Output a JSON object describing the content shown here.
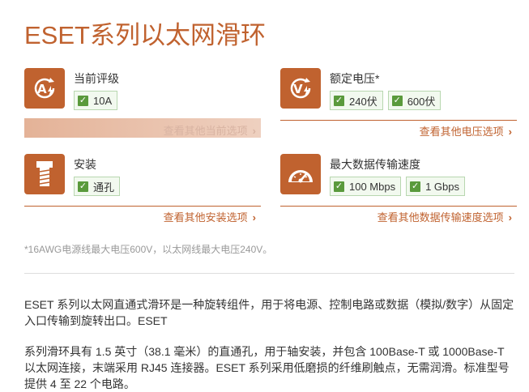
{
  "page": {
    "title": "ESET系列以太网滑环"
  },
  "specs": [
    {
      "label": "当前评级",
      "icon": "amp-rating-icon",
      "chips": [
        "10A"
      ],
      "link": "查看其他当前选项"
    },
    {
      "label": "额定电压*",
      "icon": "voltage-icon",
      "chips": [
        "240伏",
        "600伏"
      ],
      "link": "查看其他电压选项"
    },
    {
      "label": "安装",
      "icon": "bolt-icon",
      "chips": [
        "通孔"
      ],
      "link": "查看其他安装选项"
    },
    {
      "label": "最大数据传输速度",
      "icon": "speedometer-icon",
      "chips": [
        "100 Mbps",
        "1 Gbps"
      ],
      "link": "查看其他数据传输速度选项"
    }
  ],
  "note": "*16AWG电源线最大电压600V，以太网线最大电压240V。",
  "description": [
    "ESET 系列以太网直通式滑环是一种旋转组件，用于将电源、控制电路或数据（模拟/数字）从固定入口传输到旋转出口。ESET",
    "系列滑环具有 1.5 英寸（38.1 毫米）的直通孔，用于轴安装，并包含 100Base-T 或 1000Base-T 以太网连接，末端采用 RJ45 连接器。ESET 系列采用低磨损的纤维刷触点，无需润滑。标准型号提供 4 至 22 个电路。"
  ],
  "colors": {
    "accent": "#c0622f",
    "check": "#5a9a3c"
  }
}
